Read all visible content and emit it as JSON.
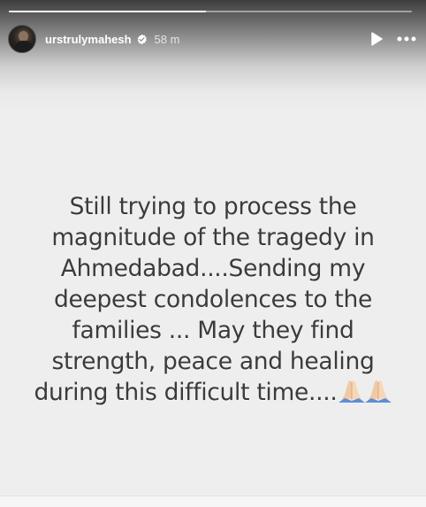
{
  "story": {
    "progress_fraction": 0.49,
    "username": "urstrulymahesh",
    "verified": true,
    "timestamp": "58 m",
    "icons": {
      "play": "play-icon",
      "more": "more-options-icon",
      "verified": "verified-badge-icon"
    },
    "caption_lines": [
      "Still trying to process the",
      "magnitude of the tragedy in",
      "Ahmedabad....Sending my",
      "deepest condolences to the",
      "families ... May they find",
      "strength, peace and healing",
      "during this difficult time...."
    ],
    "caption_emoji": "🙏🏻🙏🏻"
  }
}
